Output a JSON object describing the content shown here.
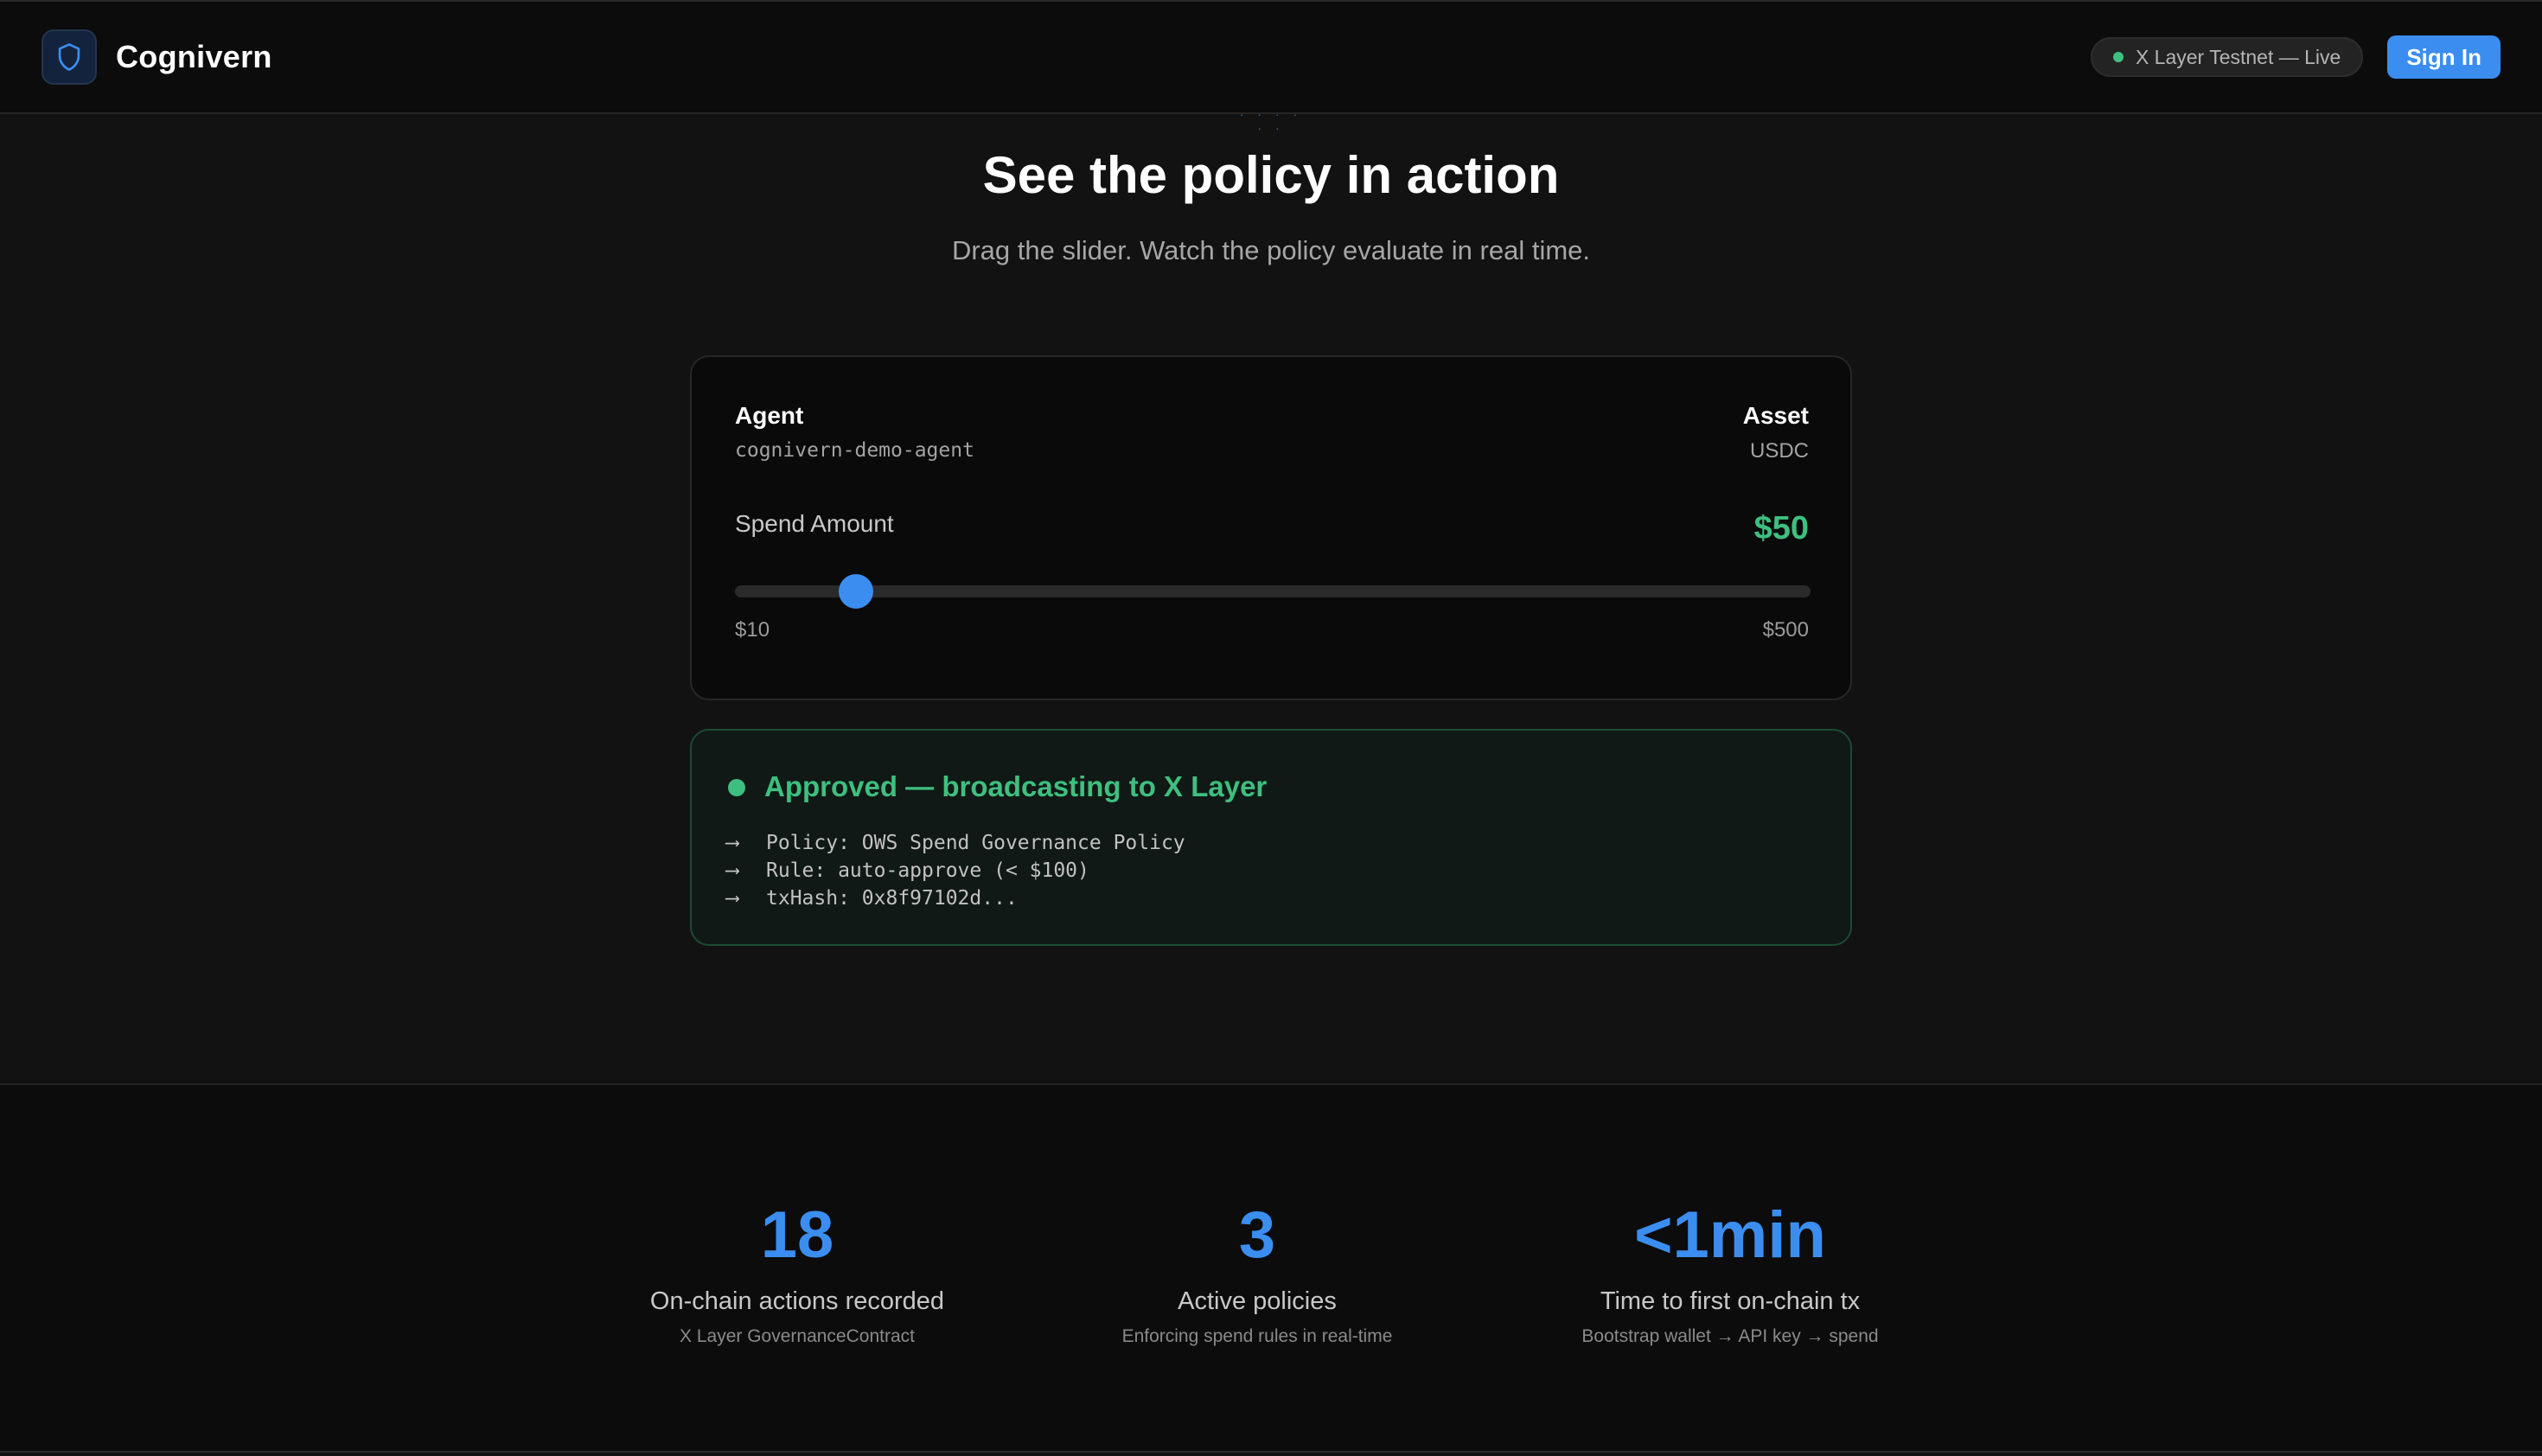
{
  "brand": {
    "name": "Cognivern",
    "logo_icon": "shield-icon",
    "accent": "#3b8ef0"
  },
  "nav": {
    "network_status": "X Layer Testnet — Live",
    "status_color": "#3fbf7f",
    "signin_label": "Sign In"
  },
  "hero": {
    "eyebrow": "· · · · · ·",
    "title": "See the policy in action",
    "subtitle": "Drag the slider. Watch the policy evaluate in real time."
  },
  "demo": {
    "agent_label": "Agent",
    "agent_value": "cognivern-demo-agent",
    "asset_label": "Asset",
    "asset_value": "USDC",
    "spend_label": "Spend Amount",
    "spend_value": "$50",
    "slider": {
      "min": 10,
      "max": 500,
      "value": 50,
      "min_label": "$10",
      "max_label": "$500"
    }
  },
  "result": {
    "status_title": "Approved — broadcasting to X Layer",
    "status_color": "#3fbf7f",
    "details": [
      {
        "arrow": "⟶",
        "text": "Policy: OWS Spend Governance Policy"
      },
      {
        "arrow": "⟶",
        "text": "Rule: auto-approve (< $100)"
      },
      {
        "arrow": "⟶",
        "text": "txHash: 0x8f97102d..."
      }
    ]
  },
  "stats": [
    {
      "value": "18",
      "label": "On-chain actions recorded",
      "sub": "X Layer GovernanceContract"
    },
    {
      "value": "3",
      "label": "Active policies",
      "sub": "Enforcing spend rules in real-time"
    },
    {
      "value": "<1min",
      "label": "Time to first on-chain tx",
      "sub": "Bootstrap wallet → API key → spend"
    }
  ]
}
